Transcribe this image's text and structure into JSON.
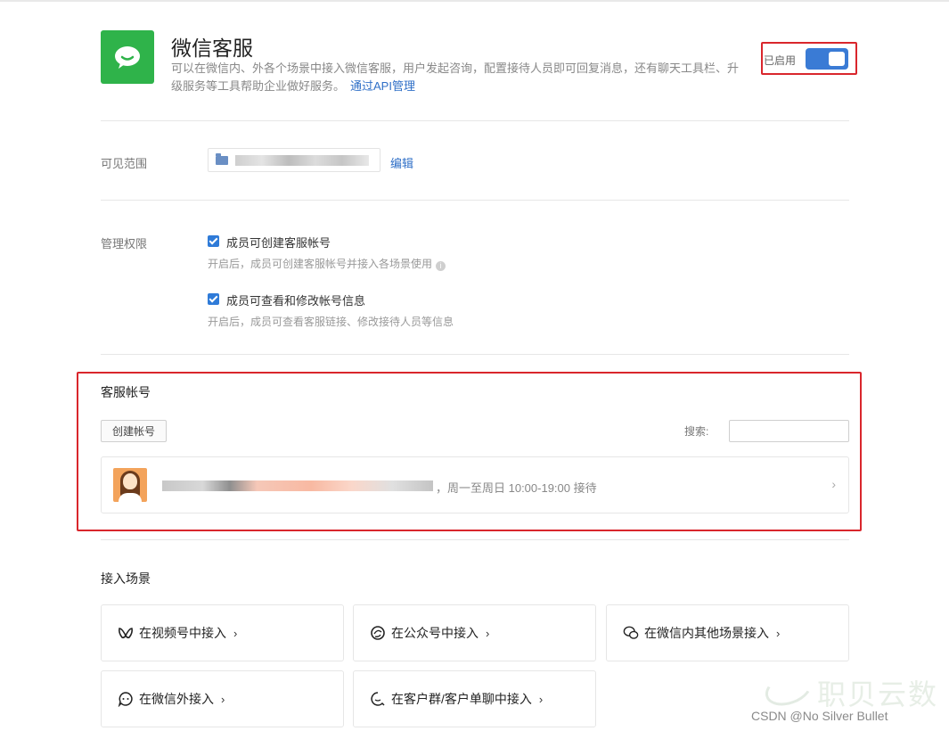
{
  "header": {
    "title": "微信客服",
    "description": "可以在微信内、外各个场景中接入微信客服，用户发起咨询，配置接待人员即可回复消息，还有聊天工具栏、升级服务等工具帮助企业做好服务。",
    "api_link": "通过API管理",
    "toggle_label": "已启用",
    "toggle_on": true,
    "icon": "wechat-chat-icon",
    "icon_color": "#2fb34a"
  },
  "visibility": {
    "label": "可见范围",
    "edit_link": "编辑"
  },
  "permissions": {
    "label": "管理权限",
    "items": [
      {
        "label": "成员可创建客服帐号",
        "hint": "开启后，成员可创建客服帐号并接入各场景使用",
        "checked": true
      },
      {
        "label": "成员可查看和修改帐号信息",
        "hint": "开启后，成员可查看客服链接、修改接待人员等信息",
        "checked": true
      }
    ]
  },
  "accounts": {
    "title": "客服帐号",
    "create_button": "创建帐号",
    "search_label": "搜索:",
    "search_placeholder": "",
    "rows": [
      {
        "hours": "，周一至周日 10:00-19:00 接待",
        "arrow": "›"
      }
    ]
  },
  "scenes": {
    "title": "接入场景",
    "items": [
      {
        "label": "在视频号中接入",
        "icon": "channels-icon",
        "chevron": "›"
      },
      {
        "label": "在公众号中接入",
        "icon": "official-account-icon",
        "chevron": "›"
      },
      {
        "label": "在微信内其他场景接入",
        "icon": "wechat-icon",
        "chevron": "›"
      },
      {
        "label": "在微信外接入",
        "icon": "chat-bubble-icon",
        "chevron": "›"
      },
      {
        "label": "在客户群/客户单聊中接入",
        "icon": "customer-chat-icon",
        "chevron": "›"
      }
    ]
  },
  "watermark": {
    "brand": "职贝云数",
    "credit": "CSDN @No Silver Bullet"
  },
  "colors": {
    "accent": "#3a7bd5",
    "link": "#2f6fc7",
    "highlight_border": "#d9262c"
  }
}
